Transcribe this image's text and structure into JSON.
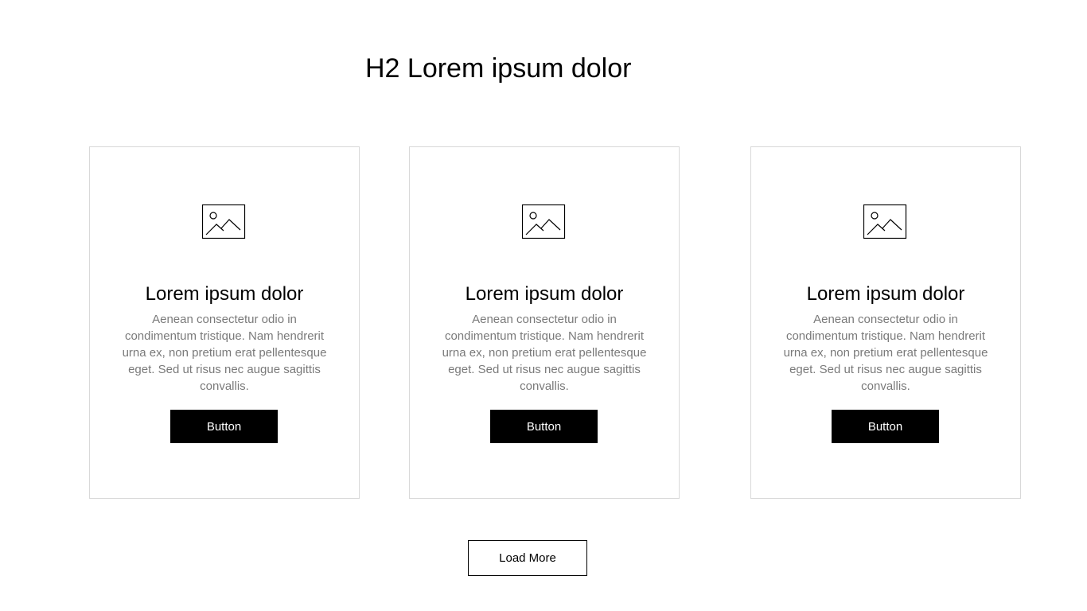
{
  "page": {
    "title": "H2 Lorem ipsum dolor"
  },
  "cards": [
    {
      "icon": "image-placeholder-icon",
      "title": "Lorem ipsum dolor",
      "text": "Aenean consectetur odio in condimentum tristique. Nam hendrerit urna ex, non pretium erat pellentesque eget. Sed ut risus nec augue sagittis convallis.",
      "button_label": "Button"
    },
    {
      "icon": "image-placeholder-icon",
      "title": "Lorem ipsum dolor",
      "text": "Aenean consectetur odio in condimentum tristique. Nam hendrerit urna ex, non pretium erat pellentesque eget. Sed ut risus nec augue sagittis convallis.",
      "button_label": "Button"
    },
    {
      "icon": "image-placeholder-icon",
      "title": "Lorem ipsum dolor",
      "text": "Aenean consectetur odio in condimentum tristique. Nam hendrerit urna ex, non pretium erat pellentesque eget. Sed ut risus nec augue sagittis convallis.",
      "button_label": "Button"
    }
  ],
  "load_more": {
    "label": "Load More"
  },
  "colors": {
    "background": "#ffffff",
    "text": "#000000",
    "body_text": "#7a7a7a",
    "card_border": "#d9d9d9",
    "button_bg": "#000000",
    "button_text": "#ffffff"
  }
}
